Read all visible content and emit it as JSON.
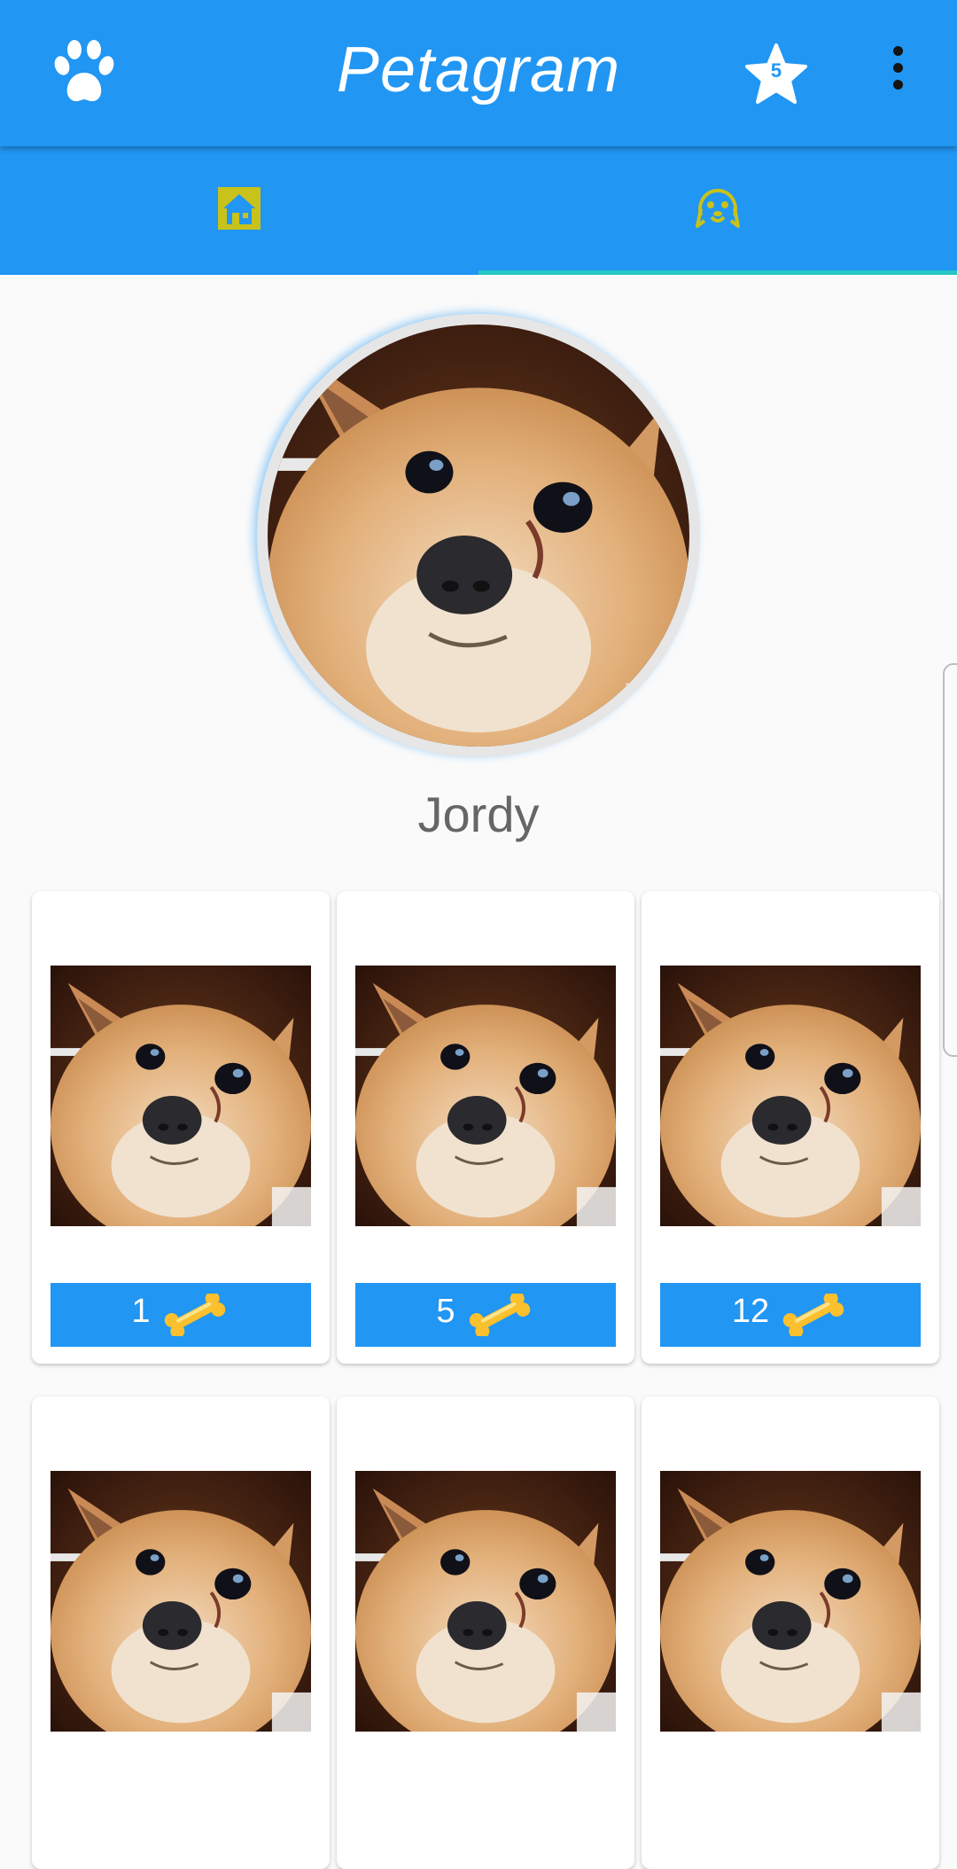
{
  "app": {
    "title": "Petagram",
    "accent_color": "#2196f3",
    "favorites_count": "5"
  },
  "toolbar": {
    "logo_icon": "paw-icon",
    "favorites_icon": "star-icon",
    "menu_icon": "more-vert-icon"
  },
  "tabs": [
    {
      "icon": "home-icon",
      "selected": false
    },
    {
      "icon": "dog-face-icon",
      "selected": true
    }
  ],
  "profile": {
    "name": "Jordy",
    "avatar": "dog-photo"
  },
  "photos": [
    {
      "likes": "1",
      "like_icon": "bone-icon"
    },
    {
      "likes": "5",
      "like_icon": "bone-icon"
    },
    {
      "likes": "12",
      "like_icon": "bone-icon"
    },
    {
      "likes": "",
      "like_icon": "bone-icon"
    },
    {
      "likes": "",
      "like_icon": "bone-icon"
    },
    {
      "likes": "",
      "like_icon": "bone-icon"
    }
  ]
}
